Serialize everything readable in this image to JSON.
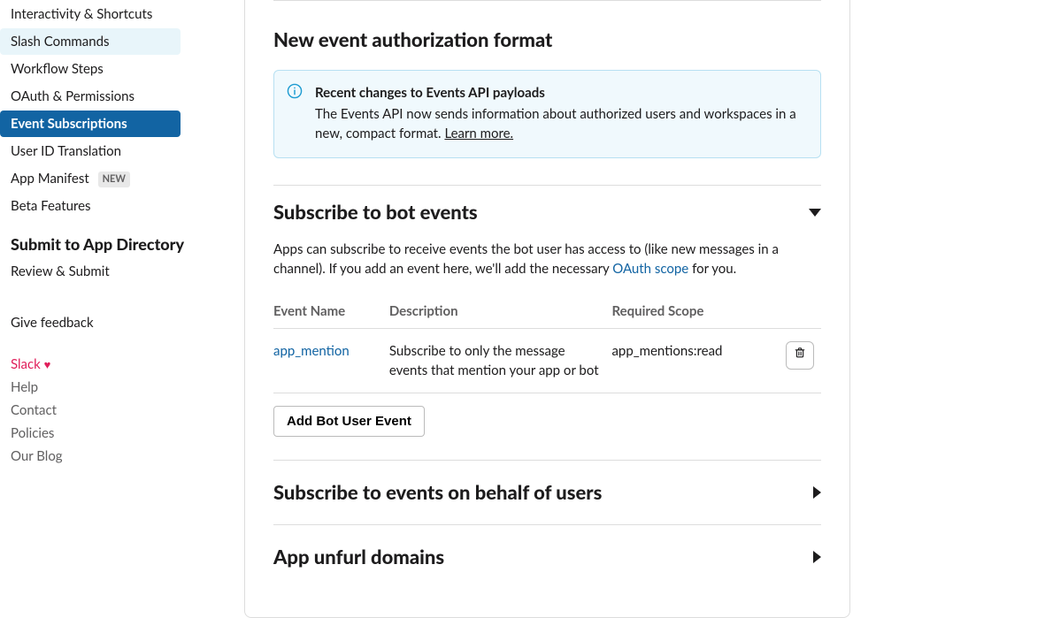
{
  "sidebar": {
    "items": [
      {
        "label": "Interactivity & Shortcuts"
      },
      {
        "label": "Slash Commands"
      },
      {
        "label": "Workflow Steps"
      },
      {
        "label": "OAuth & Permissions"
      },
      {
        "label": "Event Subscriptions"
      },
      {
        "label": "User ID Translation"
      },
      {
        "label": "App Manifest",
        "badge": "NEW"
      },
      {
        "label": "Beta Features"
      }
    ],
    "section_heading": "Submit to App Directory",
    "review_submit": "Review & Submit",
    "feedback": "Give feedback",
    "footer": {
      "slack": "Slack",
      "help": "Help",
      "contact": "Contact",
      "policies": "Policies",
      "blog": "Our Blog"
    }
  },
  "main": {
    "auth_format_title": "New event authorization format",
    "info": {
      "title": "Recent changes to Events API payloads",
      "body": "The Events API now sends information about authorized users and workspaces in a new, compact format. ",
      "learn_more": "Learn more."
    },
    "bot_events": {
      "title": "Subscribe to bot events",
      "desc_pre": "Apps can subscribe to receive events the bot user has access to (like new messages in a channel). If you add an event here, we'll add the necessary ",
      "oauth_link": "OAuth scope",
      "desc_post": " for you.",
      "columns": {
        "event": "Event Name",
        "desc": "Description",
        "scope": "Required Scope"
      },
      "rows": [
        {
          "event": "app_mention",
          "desc": "Subscribe to only the message events that mention your app or bot",
          "scope": "app_mentions:read"
        }
      ],
      "add_button": "Add Bot User Event"
    },
    "user_events_title": "Subscribe to events on behalf of users",
    "unfurl_title": "App unfurl domains"
  }
}
